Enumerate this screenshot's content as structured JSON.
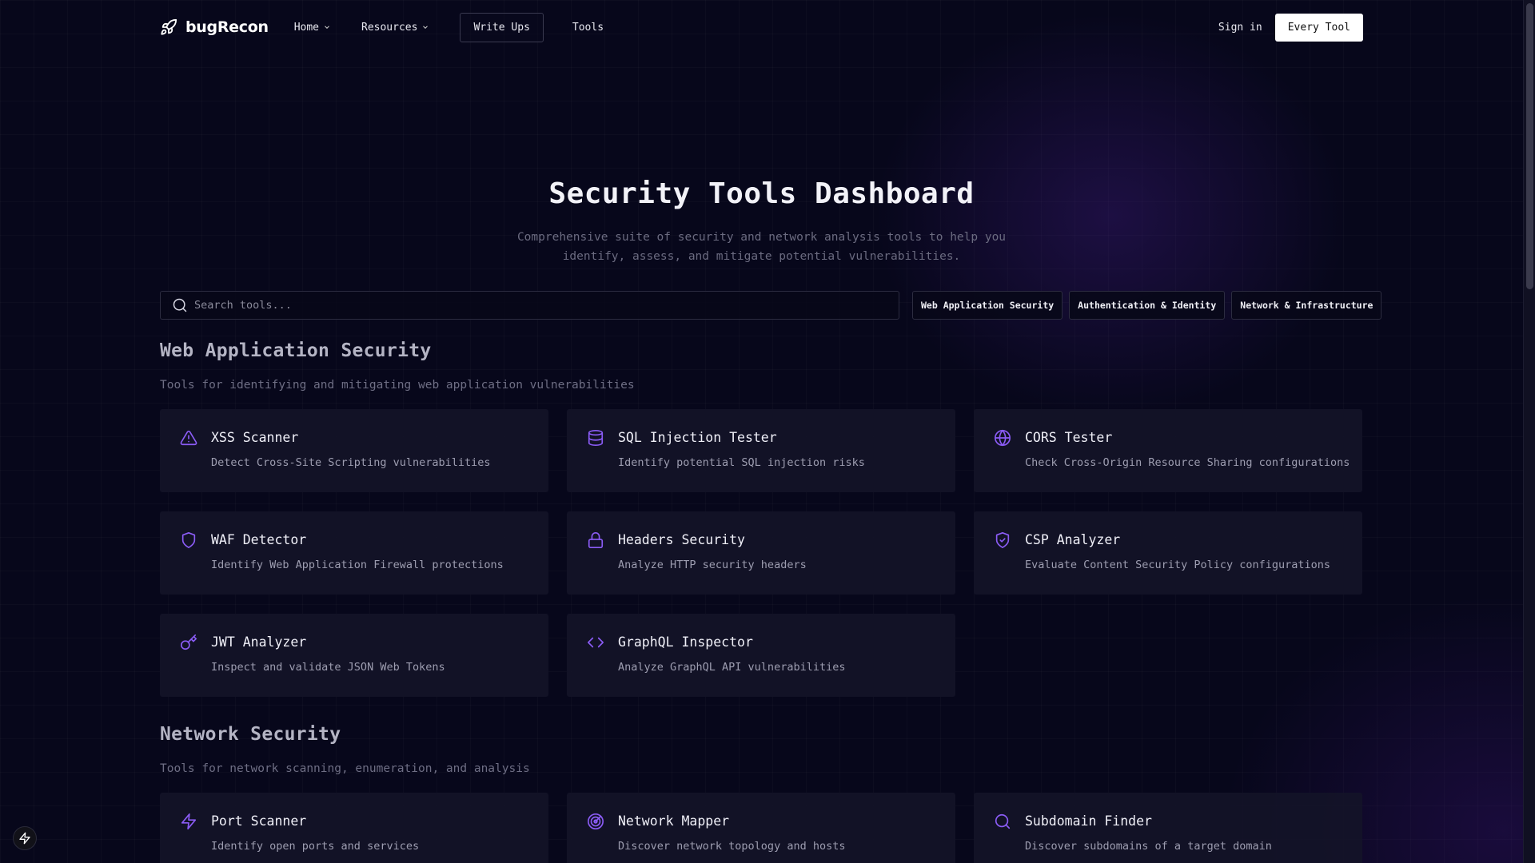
{
  "nav": {
    "logo": "bugRecon",
    "links": [
      {
        "label": "Home",
        "dropdown": true
      },
      {
        "label": "Resources",
        "dropdown": true
      },
      {
        "label": "Write Ups",
        "dropdown": false
      },
      {
        "label": "Tools",
        "dropdown": false
      }
    ],
    "signin": "Sign in",
    "cta": "Every Tool"
  },
  "hero": {
    "title": "Security Tools Dashboard",
    "subtitle": "Comprehensive suite of security and network analysis tools to help you identify, assess, and mitigate potential vulnerabilities."
  },
  "search": {
    "placeholder": "Search tools..."
  },
  "filters": [
    "Web Application Security",
    "Authentication & Identity",
    "Network & Infrastructure"
  ],
  "sections": [
    {
      "title": "Web Application Security",
      "description": "Tools for identifying and mitigating web application vulnerabilities",
      "tools": [
        {
          "icon": "warning-icon",
          "title": "XSS Scanner",
          "desc": "Detect Cross-Site Scripting vulnerabilities"
        },
        {
          "icon": "database-icon",
          "title": "SQL Injection Tester",
          "desc": "Identify potential SQL injection risks"
        },
        {
          "icon": "globe-icon",
          "title": "CORS Tester",
          "desc": "Check Cross-Origin Resource Sharing configurations"
        },
        {
          "icon": "shield-icon",
          "title": "WAF Detector",
          "desc": "Identify Web Application Firewall protections"
        },
        {
          "icon": "lock-icon",
          "title": "Headers Security",
          "desc": "Analyze HTTP security headers"
        },
        {
          "icon": "shield-check-icon",
          "title": "CSP Analyzer",
          "desc": "Evaluate Content Security Policy configurations"
        },
        {
          "icon": "key-icon",
          "title": "JWT Analyzer",
          "desc": "Inspect and validate JSON Web Tokens"
        },
        {
          "icon": "code-icon",
          "title": "GraphQL Inspector",
          "desc": "Analyze GraphQL API vulnerabilities"
        }
      ]
    },
    {
      "title": "Network Security",
      "description": "Tools for network scanning, enumeration, and analysis",
      "tools": [
        {
          "icon": "bolt-icon",
          "title": "Port Scanner",
          "desc": "Identify open ports and services"
        },
        {
          "icon": "radar-icon",
          "title": "Network Mapper",
          "desc": "Discover network topology and hosts"
        },
        {
          "icon": "search-icon",
          "title": "Subdomain Finder",
          "desc": "Discover subdomains of a target domain"
        }
      ]
    }
  ],
  "colors": {
    "accent": "#8b5cf6",
    "background": "#07071b",
    "card": "#141428"
  }
}
